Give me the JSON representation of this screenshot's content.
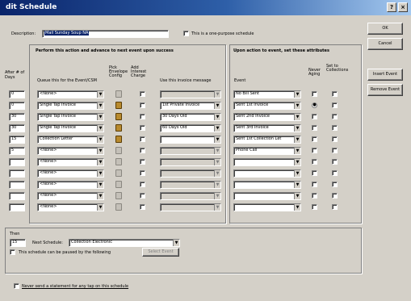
{
  "window": {
    "title": "dit Schedule"
  },
  "title_buttons": {
    "help": "?",
    "close": "×"
  },
  "description": {
    "label": "Description:",
    "value": "Mail Sunday Soup NA",
    "onetime_label": "This is a one-purpose schedule"
  },
  "action_buttons": {
    "ok": "OK",
    "cancel": "Cancel",
    "insert": "Insert Event",
    "remove": "Remove Event"
  },
  "left_section": {
    "title": "Perform this action and advance to next event upon success",
    "col_days": "After # of Days",
    "col_queue": "Queue this for the Event/CSM",
    "col_envelope": "Pick Envelope Config",
    "col_notes": "Add Interest Charge",
    "col_message": "Use this invoice message"
  },
  "right_section": {
    "title": "Upon action to event, set these attributes",
    "col_event": "Event",
    "col_never": "Never Aging",
    "col_collections": "Set to Collections"
  },
  "rows": [
    {
      "days": "0",
      "action": "<None>",
      "envelope": "off",
      "message": "",
      "msg_enabled": false,
      "event": "No Bill Sent",
      "radio": false
    },
    {
      "days": "0",
      "action": "Single Tap Invoice",
      "envelope": "on",
      "message": "1st Private Invoice",
      "msg_enabled": true,
      "event": "Sent 1st Invoice",
      "radio": true
    },
    {
      "days": "30",
      "action": "Single Tap Invoice",
      "envelope": "on",
      "message": "30 Days Old",
      "msg_enabled": true,
      "event": "Sent 2nd Invoice",
      "radio": false
    },
    {
      "days": "30",
      "action": "Single Tap Invoice",
      "envelope": "on",
      "message": "60 Days Old",
      "msg_enabled": true,
      "event": "Sent 3rd Invoice",
      "radio": false
    },
    {
      "days": "15",
      "action": "Collection Letter",
      "envelope": "on",
      "message": "",
      "msg_enabled": true,
      "event": "Sent 1st Collection Let",
      "radio": false
    },
    {
      "days": "5",
      "action": "<None>",
      "envelope": "off",
      "message": "",
      "msg_enabled": false,
      "event": "Phone Call",
      "radio": false
    },
    {
      "days": "",
      "action": "<None>",
      "envelope": "off",
      "message": "",
      "msg_enabled": false,
      "event": "",
      "radio": false
    },
    {
      "days": "",
      "action": "<None>",
      "envelope": "off",
      "message": "",
      "msg_enabled": false,
      "event": "",
      "radio": false
    },
    {
      "days": "",
      "action": "<None>",
      "envelope": "off",
      "message": "",
      "msg_enabled": false,
      "event": "",
      "radio": false
    },
    {
      "days": "",
      "action": "<None>",
      "envelope": "off",
      "message": "",
      "msg_enabled": false,
      "event": "",
      "radio": false
    },
    {
      "days": "",
      "action": "<None>",
      "envelope": "off",
      "message": "",
      "msg_enabled": false,
      "event": "",
      "radio": false
    }
  ],
  "after": {
    "label": "Then",
    "days": "15",
    "next_label": "Next Schedule:",
    "next_value": "Collection Electronic",
    "pause_label": "This schedule can be paused by the following",
    "pause_button": "Select Event"
  },
  "footer": {
    "never_label": "Never send a statement for any tap on this schedule"
  }
}
